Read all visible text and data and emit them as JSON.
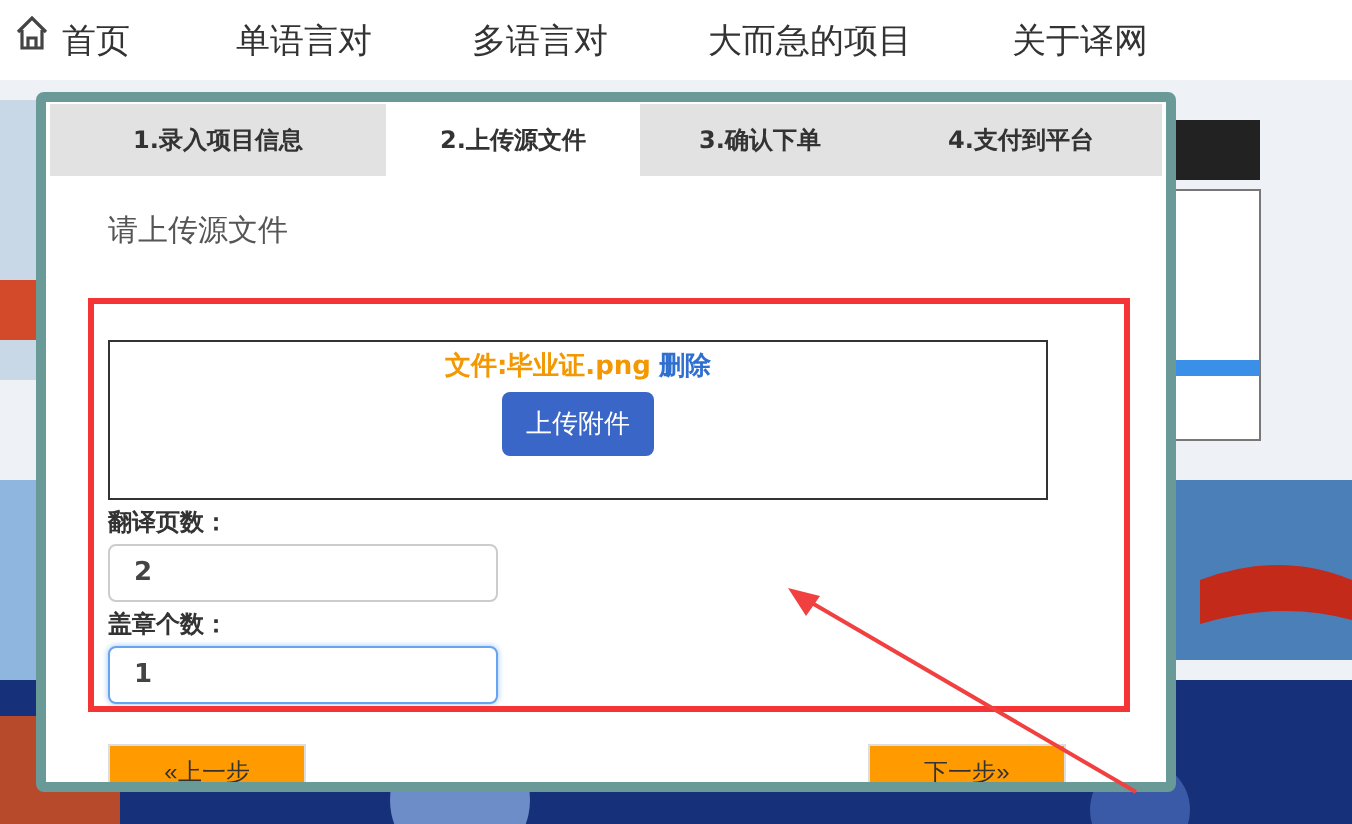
{
  "nav": {
    "items": [
      {
        "label": "首页",
        "kind": "home"
      },
      {
        "label": "单语言对",
        "kind": "link"
      },
      {
        "label": "多语言对",
        "kind": "link"
      },
      {
        "label": "大而急的项目",
        "kind": "link"
      },
      {
        "label": "关于译网",
        "kind": "link"
      }
    ]
  },
  "dialog": {
    "tabs": [
      {
        "label": "1.录入项目信息",
        "selected": false
      },
      {
        "label": "2.上传源文件",
        "selected": true
      },
      {
        "label": "3.确认下单",
        "selected": false
      },
      {
        "label": "4.支付到平台",
        "selected": false
      }
    ],
    "heading": "请上传源文件",
    "upload": {
      "file_label": "文件:毕业证.png",
      "delete_link": "删除",
      "upload_button": "上传附件"
    },
    "fields": [
      {
        "label": "翻译页数：",
        "value": "2",
        "focused": false
      },
      {
        "label": "盖章个数：",
        "value": "1",
        "focused": true
      }
    ],
    "prev_button": "«上一步",
    "next_button": "下一步»"
  }
}
